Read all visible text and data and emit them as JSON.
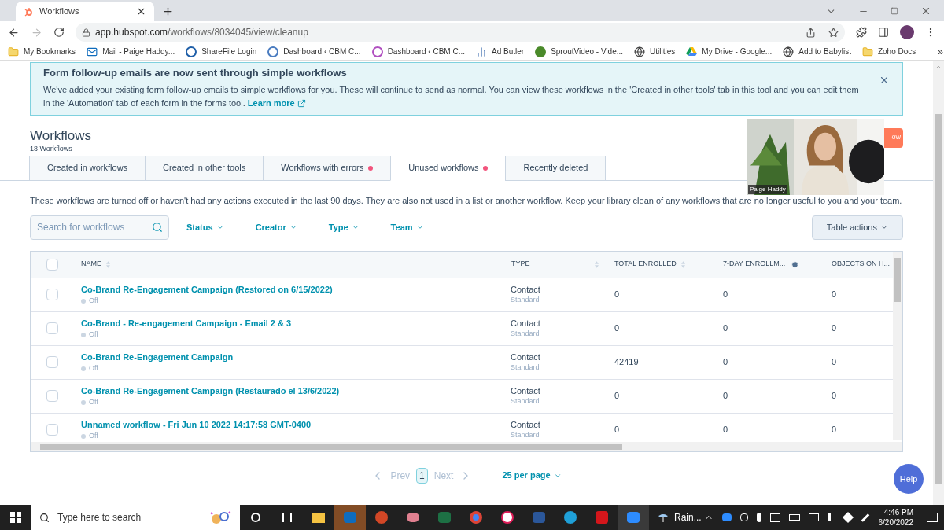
{
  "browser": {
    "tab_title": "Workflows",
    "url_host": "app.hubspot.com",
    "url_path": "/workflows/8034045/view/cleanup",
    "bookmarks": [
      {
        "label": "My Bookmarks",
        "kind": "folder"
      },
      {
        "label": "Mail - Paige Haddy...",
        "kind": "mail"
      },
      {
        "label": "ShareFile Login",
        "kind": "sharefile"
      },
      {
        "label": "Dashboard ‹ CBM C...",
        "kind": "dash1"
      },
      {
        "label": "Dashboard ‹ CBM C...",
        "kind": "dash2"
      },
      {
        "label": "Ad Butler",
        "kind": "chart"
      },
      {
        "label": "SproutVideo - Vide...",
        "kind": "sprout"
      },
      {
        "label": "Utilities",
        "kind": "globe"
      },
      {
        "label": "My Drive - Google...",
        "kind": "drive"
      },
      {
        "label": "Add to Babylist",
        "kind": "globe"
      },
      {
        "label": "Zoho Docs",
        "kind": "folder"
      }
    ],
    "more": "»"
  },
  "banner": {
    "title": "Form follow-up emails are now sent through simple workflows",
    "text": "We've added your existing form follow-up emails to simple workflows for you. These will continue to send as normal. You can view these workflows in the 'Created in other tools' tab in this tool and you can edit them in the 'Automation' tab of each form in the forms tool.",
    "link": "Learn more"
  },
  "header": {
    "title": "Workflows",
    "count": "18 Workflows",
    "create_button": "ow"
  },
  "video": {
    "name_label": "Paige Haddy"
  },
  "tabs": [
    {
      "label": "Created in workflows",
      "selected": false,
      "alert": false
    },
    {
      "label": "Created in other tools",
      "selected": false,
      "alert": false
    },
    {
      "label": "Workflows with errors",
      "selected": false,
      "alert": true
    },
    {
      "label": "Unused workflows",
      "selected": true,
      "alert": true
    },
    {
      "label": "Recently deleted",
      "selected": false,
      "alert": false
    }
  ],
  "description": "These workflows are turned off or haven't had any actions executed in the last 90 days. They are also not used in a list or another workflow. Keep your library clean of any workflows that are no longer useful to you and your team.",
  "filters": {
    "search_placeholder": "Search for workflows",
    "dropdowns": [
      "Status",
      "Creator",
      "Type",
      "Team"
    ],
    "table_actions": "Table actions"
  },
  "table": {
    "select_all_checked": false,
    "columns": [
      {
        "label": "NAME",
        "sortable": true,
        "info": false
      },
      {
        "label": "TYPE",
        "sortable": true,
        "info": false
      },
      {
        "label": "TOTAL ENROLLED",
        "sortable": true,
        "info": false
      },
      {
        "label": "7-DAY ENROLLM...",
        "sortable": false,
        "info": true
      },
      {
        "label": "OBJECTS ON H...",
        "sortable": false,
        "info": false
      }
    ],
    "rows": [
      {
        "checked": false,
        "name": "Co-Brand Re-Engagement Campaign (Restored on 6/15/2022)",
        "status": "Off",
        "type": "Contact",
        "subtype": "Standard",
        "total": "0",
        "seven_day": "0",
        "objects": "0"
      },
      {
        "checked": false,
        "name": "Co-Brand - Re-engagement Campaign - Email 2 & 3",
        "status": "Off",
        "type": "Contact",
        "subtype": "Standard",
        "total": "0",
        "seven_day": "0",
        "objects": "0"
      },
      {
        "checked": false,
        "name": "Co-Brand Re-Engagement Campaign",
        "status": "Off",
        "type": "Contact",
        "subtype": "Standard",
        "total": "42419",
        "seven_day": "0",
        "objects": "0"
      },
      {
        "checked": false,
        "name": "Co-Brand Re-Engagement Campaign (Restaurado el 13/6/2022)",
        "status": "Off",
        "type": "Contact",
        "subtype": "Standard",
        "total": "0",
        "seven_day": "0",
        "objects": "0"
      },
      {
        "checked": false,
        "name": "Unnamed workflow - Fri Jun 10 2022 14:17:58 GMT-0400",
        "status": "Off",
        "type": "Contact",
        "subtype": "Standard",
        "total": "0",
        "seven_day": "0",
        "objects": "0"
      }
    ]
  },
  "pagination": {
    "prev": "Prev",
    "page": "1",
    "next": "Next",
    "per_page": "25 per page"
  },
  "help": "Help",
  "taskbar": {
    "search_placeholder": "Type here to search",
    "weather": "Rain...",
    "time": "4:46 PM",
    "date": "6/20/2022"
  }
}
